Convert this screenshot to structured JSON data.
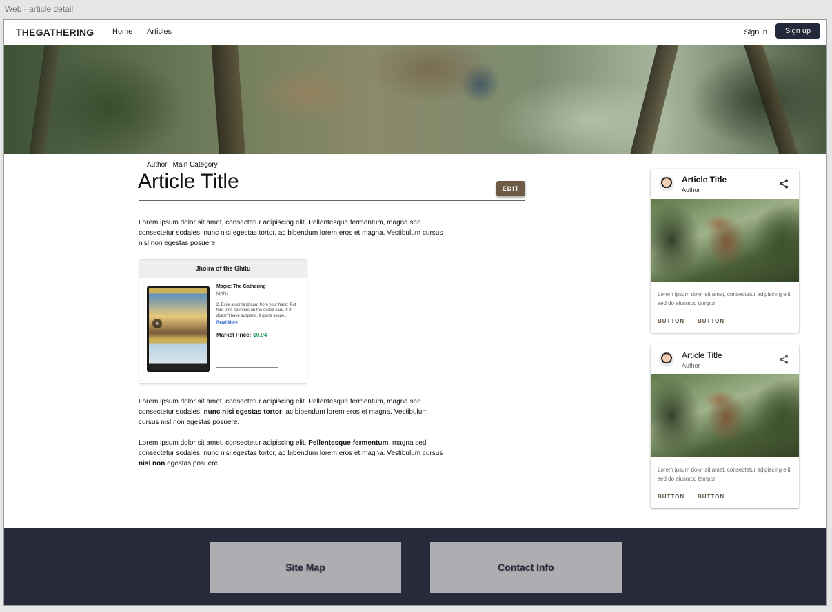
{
  "frame_label": "Web - article detail",
  "nav": {
    "logo": "THEGATHERING",
    "links": [
      "Home",
      "Articles"
    ],
    "sign_in": "Sign in",
    "sign_up": "Sign up"
  },
  "article": {
    "byline": "Author | Main Category",
    "title": "Article Title",
    "edit_label": "EDIT",
    "para1": "Lorem ipsum dolor sit amet, consectetur adipiscing elit. Pellentesque fermentum, magna sed consectetur sodales, nunc nisi egestas tortor, ac bibendum lorem eros et magna. Vestibulum cursus nisl non egestas posuere.",
    "para2": {
      "a": "Lorem ipsum dolor sit amet, consectetur adipiscing elit. Pellentesque fermentum, magna sed consectetur sodales, ",
      "b": "nunc nisi egestas tortor",
      "c": ", ac bibendum lorem eros et magna. Vestibulum cursus nisl non egestas posuere."
    },
    "para3": {
      "a": "Lorem ipsum dolor sit amet, consectetur adipiscing elit. ",
      "b": "Pellentesque fermentum",
      "c": ", magna sed consectetur sodales, nunc nisi egestas tortor, ac bibendum lorem eros et magna. Vestibulum cursus ",
      "d": "nisl non",
      "e": " egestas posuere."
    }
  },
  "product": {
    "name": "Jhoira of the Ghitu",
    "set": "Magic: The Gathering",
    "rarity": "Mythic",
    "description": "2, Exile a nonland card from your hand: Put four time counters on the exiled card. If it doesn't have suspend, it gains suspe...",
    "read_more": "Read More",
    "price_label": "Market Price:",
    "price": "$0.94"
  },
  "side_cards": [
    {
      "title": "Article Title",
      "author": "Author",
      "text": "Lorem ipsum dolor sit amet, consectetur adipiscing elit, sed do eiusmod tempor",
      "buttons": [
        "BUTTON",
        "BUTTON"
      ]
    },
    {
      "title": "Article Title",
      "author": "Author",
      "text": "Lorem ipsum dolor sit amet, consectetur adipiscing elit, sed do eiusmod tempor",
      "buttons": [
        "BUTTON",
        "BUTTON"
      ]
    }
  ],
  "footer": {
    "site_map": "Site Map",
    "contact": "Contact Info"
  },
  "colors": {
    "signup_bg": "#23283a",
    "edit_bg": "#6d5b45",
    "price": "#1b9a5c",
    "footer_bg": "#262a3b",
    "footer_box": "#adadb2"
  }
}
